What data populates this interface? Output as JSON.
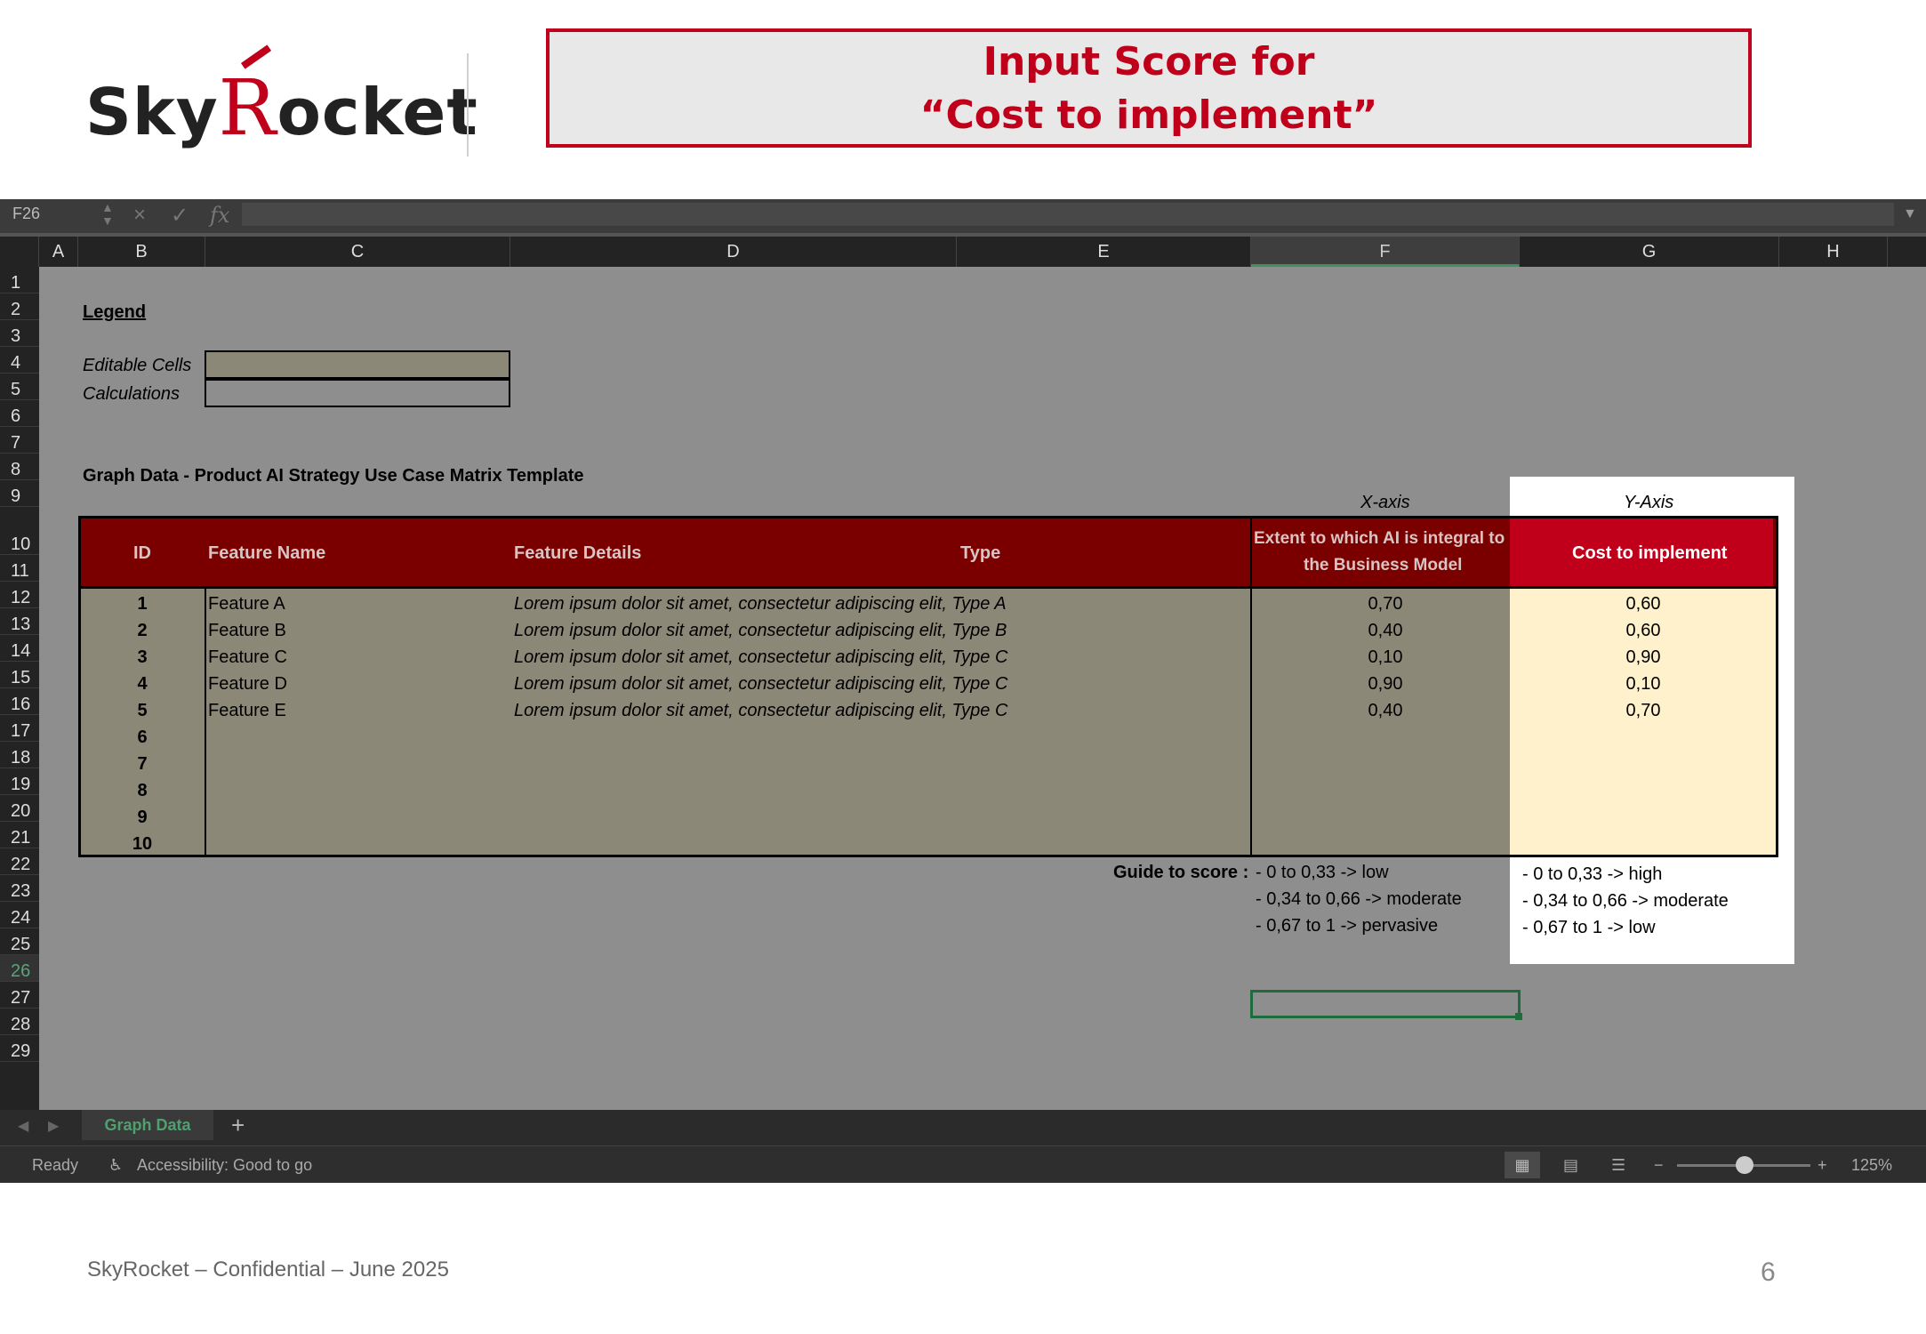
{
  "brand": {
    "logo_text_1": "Sky",
    "logo_text_2": "R",
    "logo_text_3": "ocket"
  },
  "title": {
    "line1": "Input Score for",
    "line2": "“Cost to implement”"
  },
  "formula_bar": {
    "name_box": "F26",
    "fx": "fx",
    "cancel": "×",
    "confirm": "✓"
  },
  "columns": [
    "A",
    "B",
    "C",
    "D",
    "E",
    "F",
    "G",
    "H"
  ],
  "rows": [
    "1",
    "2",
    "3",
    "4",
    "5",
    "6",
    "7",
    "8",
    "9",
    "10",
    "11",
    "12",
    "13",
    "14",
    "15",
    "16",
    "17",
    "18",
    "19",
    "20",
    "21",
    "22",
    "23",
    "24",
    "25",
    "26",
    "27",
    "28",
    "29"
  ],
  "legend": {
    "title": "Legend",
    "editable": "Editable Cells",
    "calculations": "Calculations"
  },
  "graph_title": "Graph Data - Product AI Strategy Use Case Matrix Template",
  "axis_labels": {
    "x": "X-axis",
    "y": "Y-Axis"
  },
  "table": {
    "headers": {
      "id": "ID",
      "name": "Feature Name",
      "details": "Feature Details",
      "type": "Type",
      "x_line1": "Extent to which AI is integral to",
      "x_line2": "the Business Model",
      "y": "Cost to implement"
    },
    "rows": [
      {
        "id": "1",
        "name": "Feature A",
        "details": "Lorem ipsum dolor sit amet, consectetur adipiscing elit, Type A",
        "x": "0,70",
        "y": "0,60"
      },
      {
        "id": "2",
        "name": "Feature B",
        "details": "Lorem ipsum dolor sit amet, consectetur adipiscing elit, Type B",
        "x": "0,40",
        "y": "0,60"
      },
      {
        "id": "3",
        "name": "Feature C",
        "details": "Lorem ipsum dolor sit amet, consectetur adipiscing elit, Type C",
        "x": "0,10",
        "y": "0,90"
      },
      {
        "id": "4",
        "name": "Feature D",
        "details": "Lorem ipsum dolor sit amet, consectetur adipiscing elit, Type C",
        "x": "0,90",
        "y": "0,10"
      },
      {
        "id": "5",
        "name": "Feature E",
        "details": "Lorem ipsum dolor sit amet, consectetur adipiscing elit, Type C",
        "x": "0,40",
        "y": "0,70"
      },
      {
        "id": "6",
        "name": "",
        "details": "",
        "x": "",
        "y": ""
      },
      {
        "id": "7",
        "name": "",
        "details": "",
        "x": "",
        "y": ""
      },
      {
        "id": "8",
        "name": "",
        "details": "",
        "x": "",
        "y": ""
      },
      {
        "id": "9",
        "name": "",
        "details": "",
        "x": "",
        "y": ""
      },
      {
        "id": "10",
        "name": "",
        "details": "",
        "x": "",
        "y": ""
      }
    ]
  },
  "guide": {
    "label": "Guide to score :",
    "x": [
      "- 0 to 0,33 -> low",
      "- 0,34 to 0,66 -> moderate",
      "- 0,67 to 1 -> pervasive"
    ],
    "y": [
      "- 0 to 0,33 -> high",
      "- 0,34 to 0,66 -> moderate",
      "- 0,67 to 1 -> low"
    ]
  },
  "sheet_tab": "Graph Data",
  "add_sheet": "+",
  "status": {
    "ready": "Ready",
    "accessibility": "Accessibility: Good to go",
    "zoom": "125%",
    "zoom_minus": "−",
    "zoom_plus": "+"
  },
  "footer": {
    "text": "SkyRocket – Confidential – June 2025",
    "page": "6"
  }
}
